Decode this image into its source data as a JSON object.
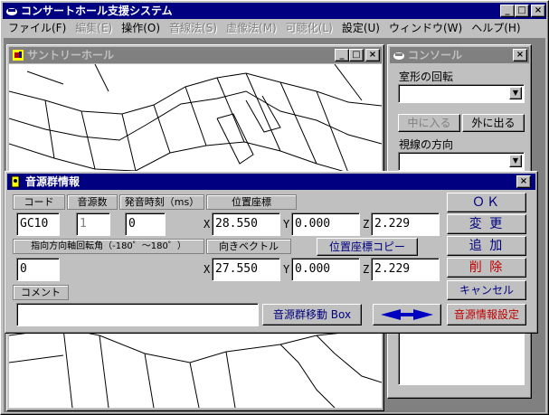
{
  "app": {
    "title": "コンサートホール支援システム",
    "btn_min": "_",
    "btn_max": "□",
    "btn_close": "×"
  },
  "menu": [
    {
      "label": "ファイル(F)",
      "enabled": true
    },
    {
      "label": "編集(E)",
      "enabled": false
    },
    {
      "label": "操作(O)",
      "enabled": true
    },
    {
      "label": "音線法(S)",
      "enabled": false
    },
    {
      "label": "虚像法(M)",
      "enabled": false
    },
    {
      "label": "可聴化(L)",
      "enabled": false
    },
    {
      "label": "設定(U)",
      "enabled": true
    },
    {
      "label": "ウィンドウ(W)",
      "enabled": true
    },
    {
      "label": "ヘルプ(H)",
      "enabled": true
    }
  ],
  "viewport": {
    "title": "サントリーホール"
  },
  "console": {
    "title": "コンソール",
    "room_rotation_label": "室形の回転",
    "inside_button": "中に入る",
    "outside_button": "外に出る",
    "view_direction_label": "視線の方向"
  },
  "dialog": {
    "title": "音源群情報",
    "labels": {
      "code": "コード",
      "count": "音源数",
      "time": "発音時刻（ms）",
      "position": "位置座標",
      "rotation": "指向方向軸回転角（-180゜～180゜）",
      "vector": "向きベクトル",
      "comment": "コメント"
    },
    "values": {
      "code": "GC10",
      "count": "1",
      "time": "0",
      "pos_x": "28.550",
      "pos_y": "0.000",
      "pos_z": "2.229",
      "rotation": "0",
      "vec_x": "27.550",
      "vec_y": "0.000",
      "vec_z": "2.229",
      "comment": ""
    },
    "axes": {
      "x": "X",
      "y": "Y",
      "z": "Z"
    },
    "buttons": {
      "copy_position": "位置座標コピー",
      "ok": "ＯＫ",
      "change": "変 更",
      "add": "追 加",
      "delete": "削 除",
      "cancel": "キャンセル",
      "source_settings": "音源情報設定",
      "move_box": "音源群移動 Box"
    }
  }
}
